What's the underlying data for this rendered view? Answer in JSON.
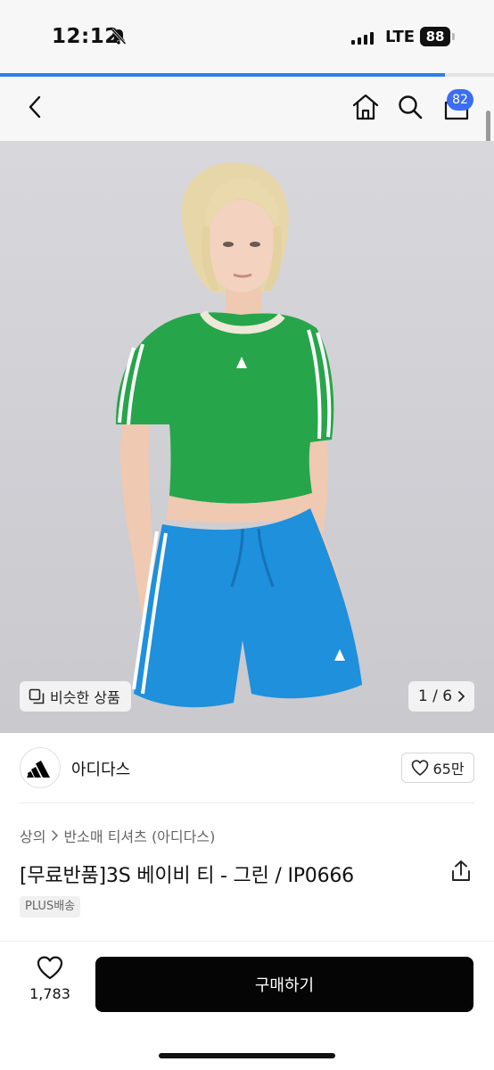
{
  "status_bar": {
    "time": "12:12",
    "network": "LTE",
    "battery": "88"
  },
  "page_progress": 0.9,
  "nav": {
    "back_icon": "chevron-left-icon",
    "home_icon": "home-icon",
    "search_icon": "search-icon",
    "cart_icon": "shopping-bag-icon",
    "cart_count": "82"
  },
  "gallery": {
    "similar_label": "비슷한 상품",
    "page_indicator": "1 / 6"
  },
  "brand": {
    "name": "아디다스",
    "likes": "65만"
  },
  "breadcrumb": {
    "category": "상의",
    "subcategory": "반소매 티셔츠 (아디다스)"
  },
  "product": {
    "title": "[무료반품]3S 베이비 티 - 그린 / IP0666",
    "shipping_badge": "PLUS배송"
  },
  "bottom_bar": {
    "wish_count": "1,783",
    "buy_label": "구매하기"
  },
  "colors": {
    "accent": "#3b6ef0",
    "buy_button": "#050505",
    "shirt_green": "#27a54a",
    "shorts_blue": "#1e90dc"
  }
}
